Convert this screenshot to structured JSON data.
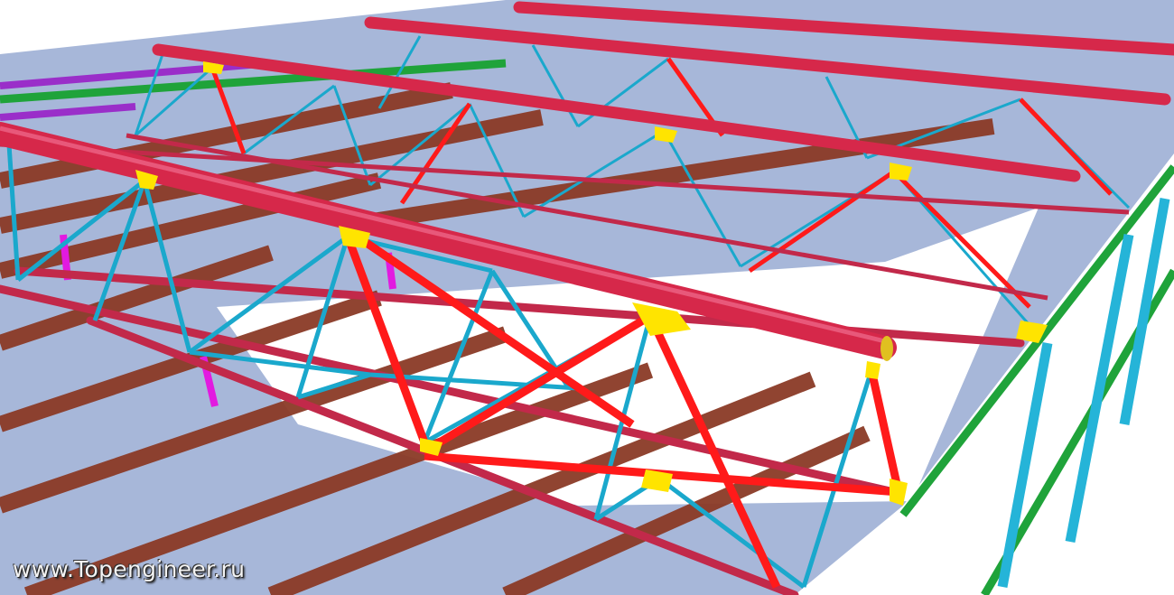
{
  "watermark": "www.Topengineer.ru",
  "colors": {
    "floor": "#a7b7d9",
    "floor_beam": "#8b3a26",
    "top_chord": "#d6284a",
    "diagonal": "#1aa8cc",
    "red_brace": "#ff1a1a",
    "node_plate": "#ffe400",
    "green_beam": "#1fa33a",
    "purple_beam": "#9a2ec9",
    "column": "#25b4d8"
  }
}
